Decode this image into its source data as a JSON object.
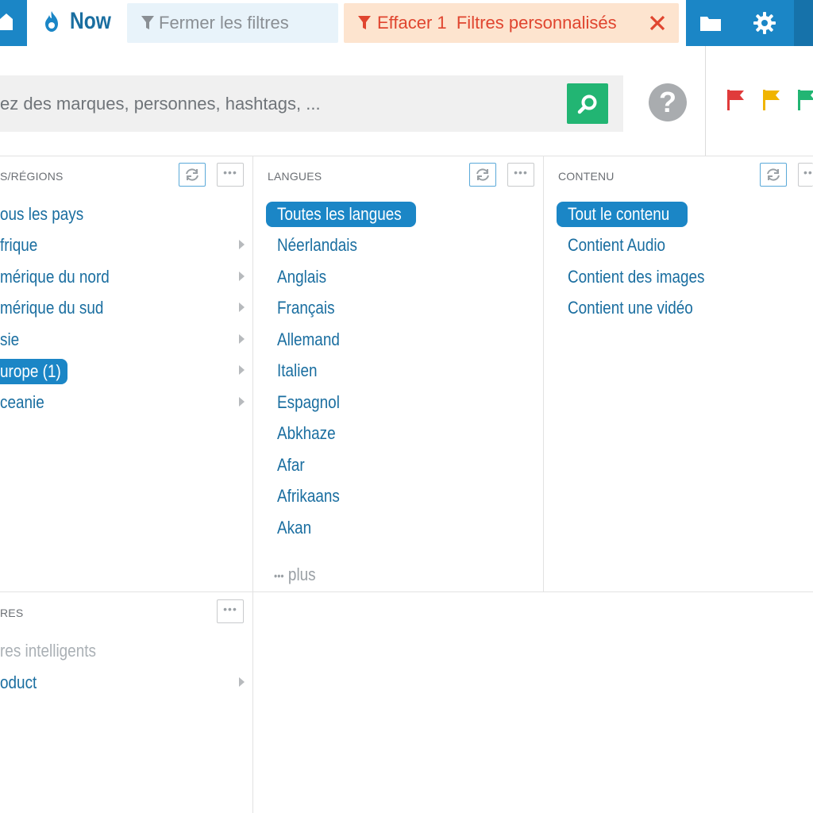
{
  "topbar": {
    "now_label": "Now",
    "close_filters_label": "Fermer les filtres",
    "clear_filters_label": "Effacer 1  Filtres personnalisés"
  },
  "search": {
    "placeholder": "ez des marques, personnes, hashtags, ..."
  },
  "help": {
    "label": "?"
  },
  "flags": [
    {
      "icon": "flag-icon",
      "color": "#e03b3b"
    },
    {
      "icon": "flag-icon",
      "color": "#f0b400"
    },
    {
      "icon": "flag-icon",
      "color": "#22b573"
    }
  ],
  "panels": {
    "regions": {
      "title": "S/RÉGIONS",
      "items": [
        {
          "label": "ous les pays",
          "has_children": false
        },
        {
          "label": "frique",
          "has_children": true
        },
        {
          "label": "mérique du nord",
          "has_children": true
        },
        {
          "label": "mérique du sud",
          "has_children": true
        },
        {
          "label": "sie",
          "has_children": true
        },
        {
          "label": "urope (1)",
          "has_children": true,
          "selected": true
        },
        {
          "label": "ceanie",
          "has_children": true
        }
      ]
    },
    "languages": {
      "title": "LANGUES",
      "selected": "Toutes les langues",
      "items": [
        "Néerlandais",
        "Anglais",
        "Français",
        "Allemand",
        "Italien",
        "Espagnol",
        "Abkhaze",
        "Afar",
        "Afrikaans",
        "Akan"
      ],
      "more_label": "plus",
      "more_dots": "•••"
    },
    "content": {
      "title": "CONTENU",
      "selected": "Tout le contenu",
      "items": [
        "Contient Audio",
        "Contient des images",
        "Contient une vidéo"
      ]
    },
    "filters": {
      "title": "RES",
      "items": [
        {
          "label": "res intelligents",
          "muted": true,
          "has_children": false
        },
        {
          "label": "oduct",
          "muted": false,
          "has_children": true
        }
      ]
    }
  },
  "mini_button": {
    "dots": "•••"
  }
}
